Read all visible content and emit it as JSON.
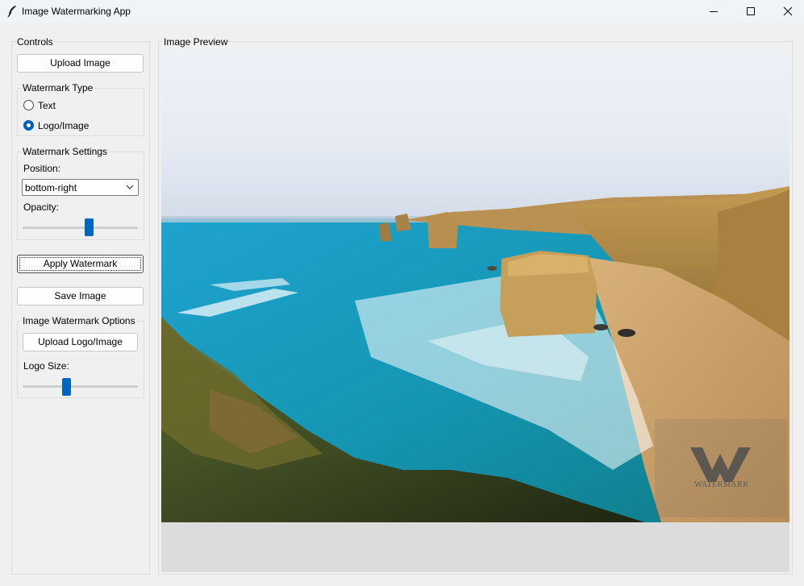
{
  "window": {
    "title": "Image Watermarking App",
    "icon": "feather-icon"
  },
  "controls": {
    "title": "Controls",
    "upload_image_label": "Upload Image",
    "watermark_type": {
      "title": "Watermark Type",
      "options": [
        {
          "label": "Text",
          "selected": false
        },
        {
          "label": "Logo/Image",
          "selected": true
        }
      ]
    },
    "settings": {
      "title": "Watermark Settings",
      "position_label": "Position:",
      "position_value": "bottom-right",
      "opacity_label": "Opacity:",
      "opacity_fraction": 0.58
    },
    "apply_label": "Apply Watermark",
    "save_label": "Save Image",
    "image_options": {
      "title": "Image Watermark Options",
      "upload_logo_label": "Upload Logo/Image",
      "logo_size_label": "Logo Size:",
      "logo_size_fraction": 0.37
    }
  },
  "preview": {
    "title": "Image Preview",
    "watermark_text": "WATERMARK"
  },
  "colors": {
    "accent": "#0067c0",
    "window_bg": "#f0f0f0",
    "titlebar_bg": "#eff4f9"
  }
}
